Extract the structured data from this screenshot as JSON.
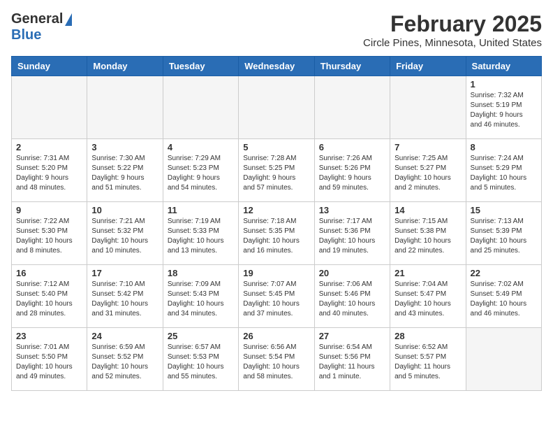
{
  "app": {
    "logo_general": "General",
    "logo_blue": "Blue",
    "title": "February 2025",
    "subtitle": "Circle Pines, Minnesota, United States"
  },
  "calendar": {
    "headers": [
      "Sunday",
      "Monday",
      "Tuesday",
      "Wednesday",
      "Thursday",
      "Friday",
      "Saturday"
    ],
    "weeks": [
      [
        {
          "day": "",
          "info": "",
          "empty": true
        },
        {
          "day": "",
          "info": "",
          "empty": true
        },
        {
          "day": "",
          "info": "",
          "empty": true
        },
        {
          "day": "",
          "info": "",
          "empty": true
        },
        {
          "day": "",
          "info": "",
          "empty": true
        },
        {
          "day": "",
          "info": "",
          "empty": true
        },
        {
          "day": "1",
          "info": "Sunrise: 7:32 AM\nSunset: 5:19 PM\nDaylight: 9 hours\nand 46 minutes."
        }
      ],
      [
        {
          "day": "2",
          "info": "Sunrise: 7:31 AM\nSunset: 5:20 PM\nDaylight: 9 hours\nand 48 minutes."
        },
        {
          "day": "3",
          "info": "Sunrise: 7:30 AM\nSunset: 5:22 PM\nDaylight: 9 hours\nand 51 minutes."
        },
        {
          "day": "4",
          "info": "Sunrise: 7:29 AM\nSunset: 5:23 PM\nDaylight: 9 hours\nand 54 minutes."
        },
        {
          "day": "5",
          "info": "Sunrise: 7:28 AM\nSunset: 5:25 PM\nDaylight: 9 hours\nand 57 minutes."
        },
        {
          "day": "6",
          "info": "Sunrise: 7:26 AM\nSunset: 5:26 PM\nDaylight: 9 hours\nand 59 minutes."
        },
        {
          "day": "7",
          "info": "Sunrise: 7:25 AM\nSunset: 5:27 PM\nDaylight: 10 hours\nand 2 minutes."
        },
        {
          "day": "8",
          "info": "Sunrise: 7:24 AM\nSunset: 5:29 PM\nDaylight: 10 hours\nand 5 minutes."
        }
      ],
      [
        {
          "day": "9",
          "info": "Sunrise: 7:22 AM\nSunset: 5:30 PM\nDaylight: 10 hours\nand 8 minutes."
        },
        {
          "day": "10",
          "info": "Sunrise: 7:21 AM\nSunset: 5:32 PM\nDaylight: 10 hours\nand 10 minutes."
        },
        {
          "day": "11",
          "info": "Sunrise: 7:19 AM\nSunset: 5:33 PM\nDaylight: 10 hours\nand 13 minutes."
        },
        {
          "day": "12",
          "info": "Sunrise: 7:18 AM\nSunset: 5:35 PM\nDaylight: 10 hours\nand 16 minutes."
        },
        {
          "day": "13",
          "info": "Sunrise: 7:17 AM\nSunset: 5:36 PM\nDaylight: 10 hours\nand 19 minutes."
        },
        {
          "day": "14",
          "info": "Sunrise: 7:15 AM\nSunset: 5:38 PM\nDaylight: 10 hours\nand 22 minutes."
        },
        {
          "day": "15",
          "info": "Sunrise: 7:13 AM\nSunset: 5:39 PM\nDaylight: 10 hours\nand 25 minutes."
        }
      ],
      [
        {
          "day": "16",
          "info": "Sunrise: 7:12 AM\nSunset: 5:40 PM\nDaylight: 10 hours\nand 28 minutes."
        },
        {
          "day": "17",
          "info": "Sunrise: 7:10 AM\nSunset: 5:42 PM\nDaylight: 10 hours\nand 31 minutes."
        },
        {
          "day": "18",
          "info": "Sunrise: 7:09 AM\nSunset: 5:43 PM\nDaylight: 10 hours\nand 34 minutes."
        },
        {
          "day": "19",
          "info": "Sunrise: 7:07 AM\nSunset: 5:45 PM\nDaylight: 10 hours\nand 37 minutes."
        },
        {
          "day": "20",
          "info": "Sunrise: 7:06 AM\nSunset: 5:46 PM\nDaylight: 10 hours\nand 40 minutes."
        },
        {
          "day": "21",
          "info": "Sunrise: 7:04 AM\nSunset: 5:47 PM\nDaylight: 10 hours\nand 43 minutes."
        },
        {
          "day": "22",
          "info": "Sunrise: 7:02 AM\nSunset: 5:49 PM\nDaylight: 10 hours\nand 46 minutes."
        }
      ],
      [
        {
          "day": "23",
          "info": "Sunrise: 7:01 AM\nSunset: 5:50 PM\nDaylight: 10 hours\nand 49 minutes."
        },
        {
          "day": "24",
          "info": "Sunrise: 6:59 AM\nSunset: 5:52 PM\nDaylight: 10 hours\nand 52 minutes."
        },
        {
          "day": "25",
          "info": "Sunrise: 6:57 AM\nSunset: 5:53 PM\nDaylight: 10 hours\nand 55 minutes."
        },
        {
          "day": "26",
          "info": "Sunrise: 6:56 AM\nSunset: 5:54 PM\nDaylight: 10 hours\nand 58 minutes."
        },
        {
          "day": "27",
          "info": "Sunrise: 6:54 AM\nSunset: 5:56 PM\nDaylight: 11 hours\nand 1 minute."
        },
        {
          "day": "28",
          "info": "Sunrise: 6:52 AM\nSunset: 5:57 PM\nDaylight: 11 hours\nand 5 minutes."
        },
        {
          "day": "",
          "info": "",
          "empty": true
        }
      ]
    ]
  }
}
